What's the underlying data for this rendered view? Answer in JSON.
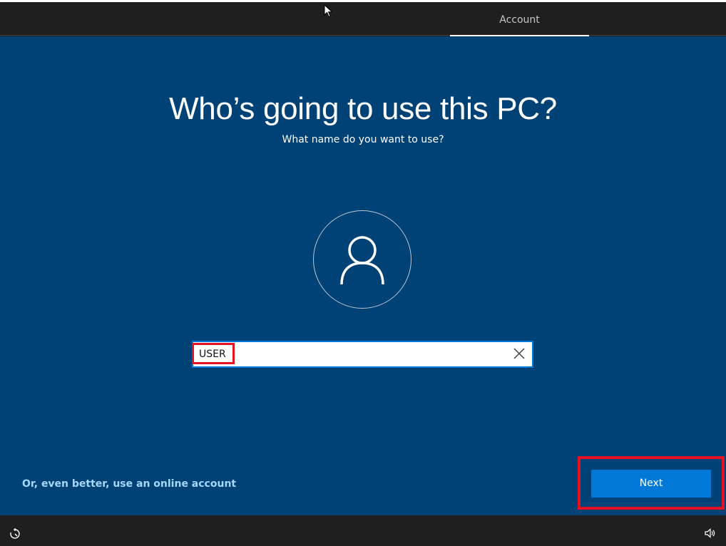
{
  "header": {
    "tab_label": "Account"
  },
  "main": {
    "title": "Who’s going to use this PC?",
    "subtitle": "What name do you want to use?",
    "name_input": {
      "value": "USER",
      "placeholder": ""
    },
    "online_account_link": "Or, even better, use an online account",
    "next_button": "Next"
  },
  "icons": {
    "avatar": "user-avatar-icon",
    "clear": "clear-x-icon",
    "cursor": "mouse-cursor-icon",
    "ease_of_access": "ease-of-access-icon",
    "volume": "volume-icon"
  },
  "colors": {
    "background": "#004275",
    "accent": "#0078d7",
    "highlight": "#e81123",
    "link": "#a6d8ff",
    "bar": "#1f1f1f"
  }
}
